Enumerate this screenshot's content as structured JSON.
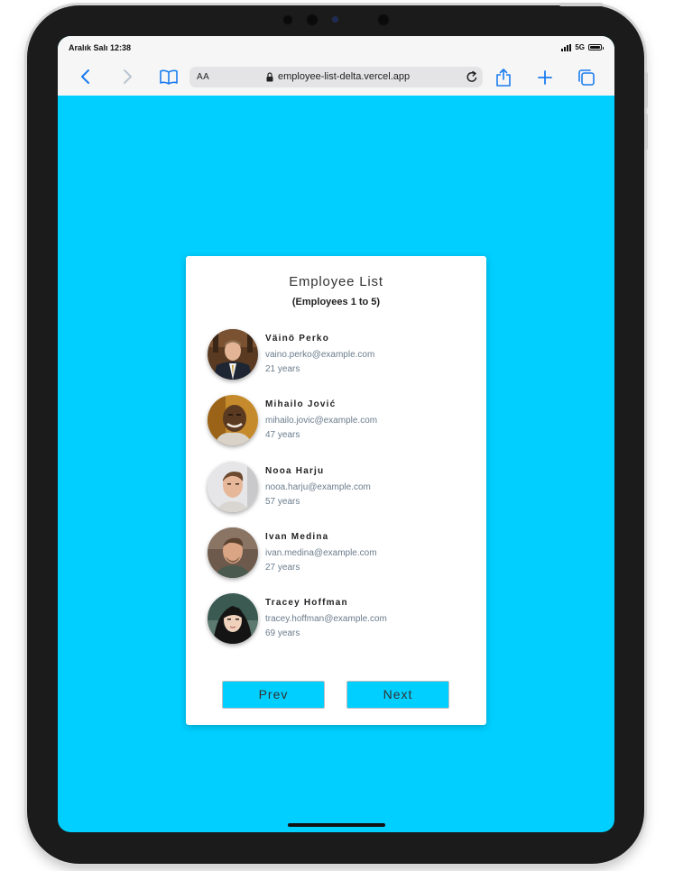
{
  "status_bar": {
    "time": "Aralık Salı 12:38",
    "network": "5G"
  },
  "browser": {
    "aa_label": "AA",
    "url": "employee-list-delta.vercel.app",
    "accent_color": "#1a7cf0"
  },
  "page": {
    "background_color": "#00cfff",
    "card": {
      "title": "Employee List",
      "subtitle": "(Employees 1 to 5)"
    },
    "employees": [
      {
        "name": "Väinö Perko",
        "email": "vaino.perko@example.com",
        "age": "21 years"
      },
      {
        "name": "Mihailo Jović",
        "email": "mihailo.jovic@example.com",
        "age": "47 years"
      },
      {
        "name": "Nooa Harju",
        "email": "nooa.harju@example.com",
        "age": "57 years"
      },
      {
        "name": "Ivan Medina",
        "email": "ivan.medina@example.com",
        "age": "27 years"
      },
      {
        "name": "Tracey Hoffman",
        "email": "tracey.hoffman@example.com",
        "age": "69 years"
      }
    ],
    "prev_label": "Prev",
    "next_label": "Next"
  }
}
